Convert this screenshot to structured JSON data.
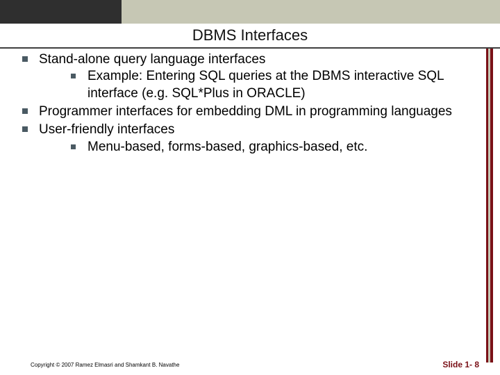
{
  "title": "DBMS Interfaces",
  "bullets": {
    "b1": "Stand-alone query language interfaces",
    "b1_1": "Example: Entering SQL queries at the DBMS interactive SQL interface (e.g. SQL*Plus in ORACLE)",
    "b2": "Programmer interfaces for embedding DML in programming languages",
    "b3": "User-friendly interfaces",
    "b3_1": "Menu-based, forms-based, graphics-based, etc."
  },
  "footer": {
    "copyright": "Copyright © 2007 Ramez Elmasri and Shamkant B. Navathe",
    "slide_number": "Slide 1- 8"
  }
}
